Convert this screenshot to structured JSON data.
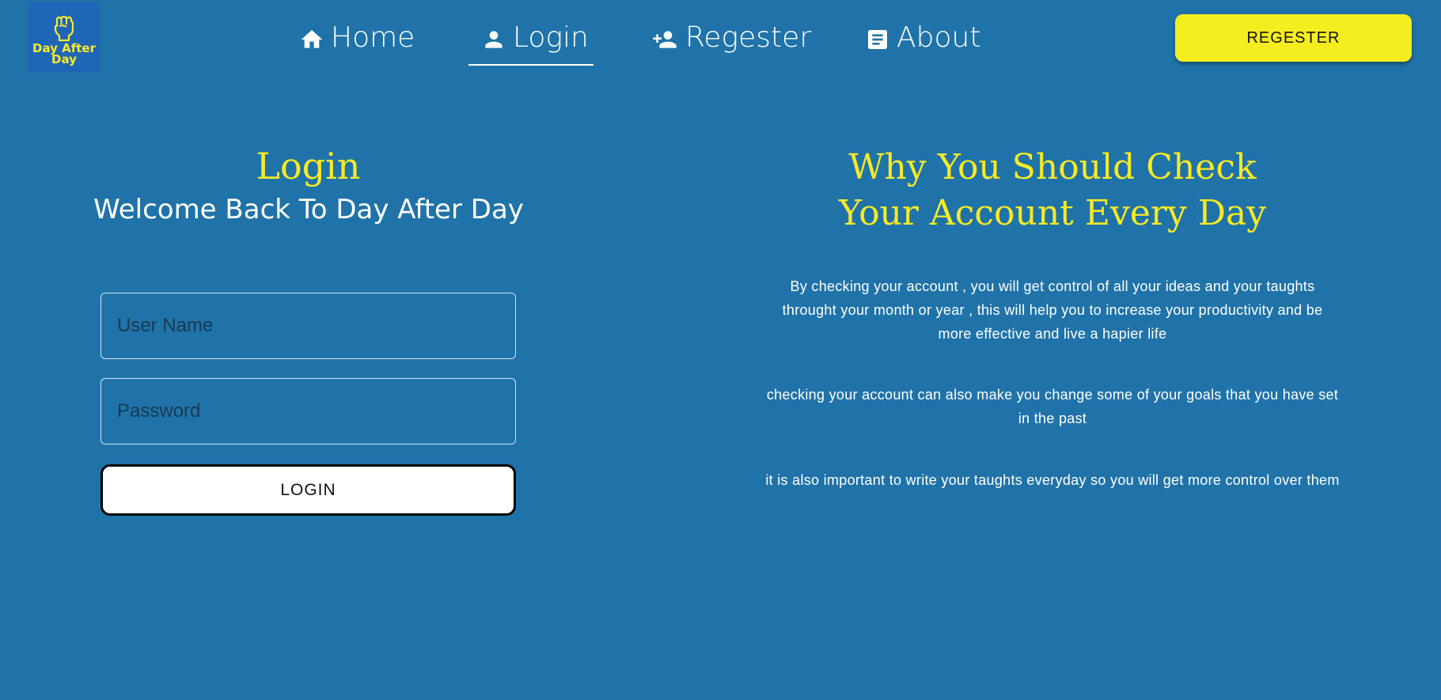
{
  "brand": {
    "logo_text": "Day After Day",
    "logo_icon": "raised-fist-icon"
  },
  "nav": {
    "items": [
      {
        "label": "Home",
        "icon": "home-icon"
      },
      {
        "label": "Login",
        "icon": "person-icon",
        "active": true
      },
      {
        "label": "Regester",
        "icon": "person-add-icon"
      },
      {
        "label": "About",
        "icon": "document-icon"
      }
    ],
    "cta_label": "REGESTER"
  },
  "login": {
    "title": "Login",
    "subtitle": "Welcome Back To Day After Day",
    "username_placeholder": "User Name",
    "password_placeholder": "Password",
    "button_label": "LOGIN"
  },
  "info": {
    "title_line1": "Why You Should Check",
    "title_line2": "Your Account Every Day",
    "paragraphs": [
      "By checking your account , you will get control of all your ideas and your taughts throught your month or year , this will help you to increase your productivity and be more effective and live a hapier life",
      "checking your account can also make you change some of your goals that you have set in the past",
      "it is also important to write your taughts everyday so you will get more control over them"
    ]
  },
  "colors": {
    "background": "#2073a8",
    "accent_yellow": "#f5ee1f",
    "logo_bg": "#1f66b8",
    "text": "#ffffff"
  }
}
